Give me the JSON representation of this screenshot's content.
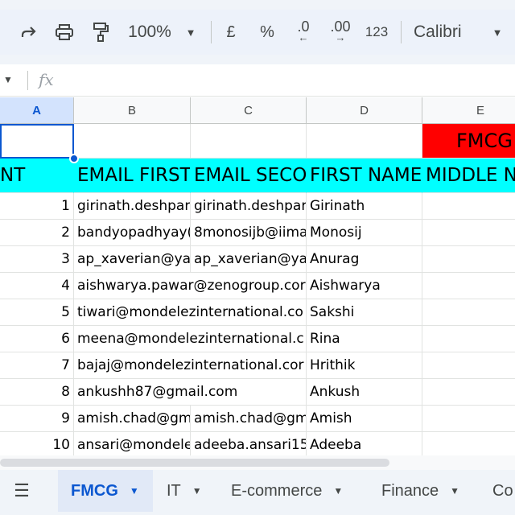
{
  "toolbar": {
    "zoom": "100%",
    "currency": "£",
    "percent": "%",
    "dec_decrease": ".0",
    "dec_increase": ".00",
    "format_num": "123",
    "font": "Calibri"
  },
  "formula_bar": {
    "fx": "fx"
  },
  "columns": [
    "A",
    "B",
    "C",
    "D",
    "E"
  ],
  "e1_value": "FMCG",
  "header_row": [
    "NT",
    "EMAIL FIRST",
    "EMAIL SECON",
    "FIRST NAME",
    "MIDDLE N"
  ],
  "rows": [
    {
      "n": "1",
      "email1": "girinath.deshpar",
      "email2": "girinath.deshpar",
      "first": "Girinath"
    },
    {
      "n": "2",
      "email1": "bandyopadhyay(",
      "email2": "8monosijb@iima",
      "first": "Monosij"
    },
    {
      "n": "3",
      "email1": "ap_xaverian@ya",
      "email2": "ap_xaverian@ya",
      "first": "Anurag"
    },
    {
      "n": "4",
      "email1": "aishwarya.pawar@zenogroup.cor",
      "email2": "",
      "first": "Aishwarya"
    },
    {
      "n": "5",
      "email1": "tiwari@mondelezinternational.co",
      "email2": "",
      "first": "Sakshi"
    },
    {
      "n": "6",
      "email1": "meena@mondelezinternational.c",
      "email2": "",
      "first": "Rina"
    },
    {
      "n": "7",
      "email1": "bajaj@mondelezinternational.cor",
      "email2": "",
      "first": "Hrithik"
    },
    {
      "n": "8",
      "email1": "ankushh87@gmail.com",
      "email2": "",
      "first": "Ankush"
    },
    {
      "n": "9",
      "email1": "amish.chad@gm",
      "email2": "amish.chad@gm",
      "first": "Amish"
    },
    {
      "n": "10",
      "email1": "ansari@mondele",
      "email2": "adeeba.ansari15",
      "first": "Adeeba"
    }
  ],
  "sheet_tabs": [
    "FMCG",
    "IT",
    "E-commerce",
    "Finance",
    "Co"
  ],
  "colors": {
    "accent": "#0b57d0",
    "header_fill": "#00ffff",
    "e1_fill": "#ff0000"
  }
}
